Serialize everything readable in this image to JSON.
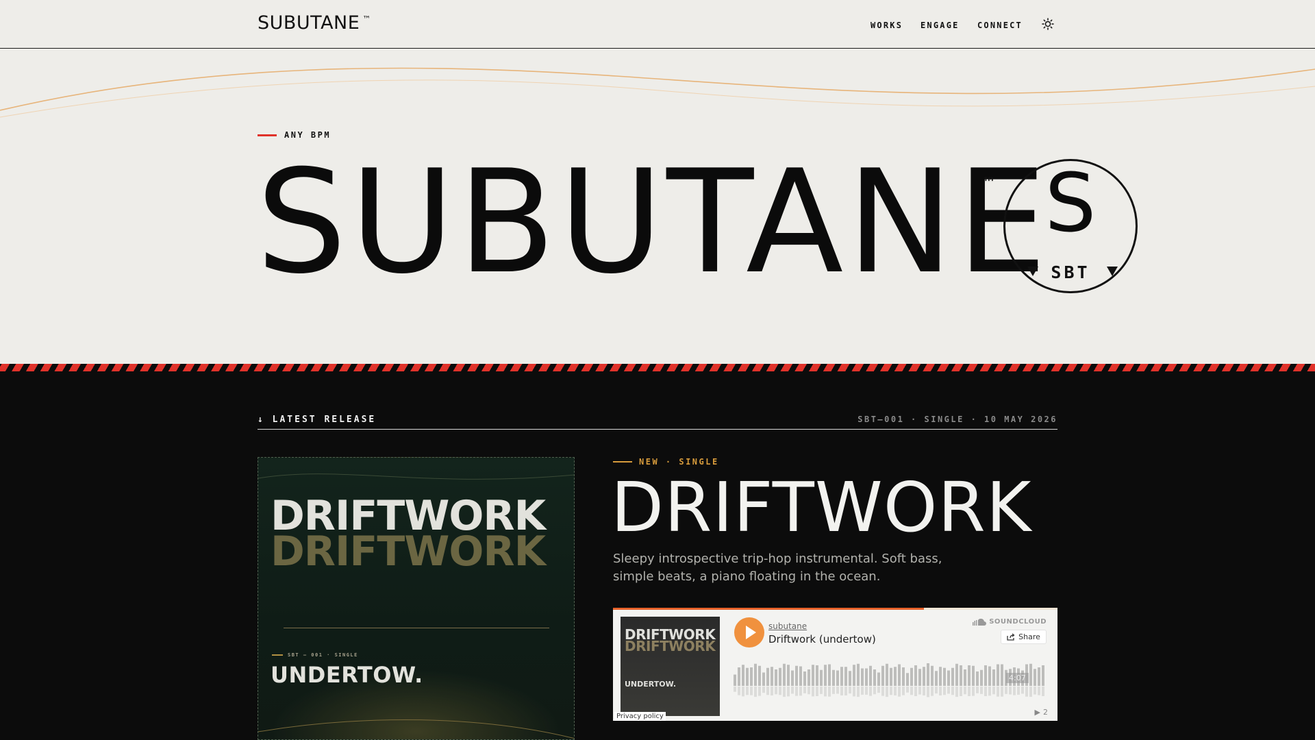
{
  "header": {
    "brand": "SUBUTANE",
    "brand_tm": "™",
    "nav": [
      "WORKS",
      "ENGAGE",
      "CONNECT"
    ],
    "theme_icon": "sun-icon"
  },
  "hero": {
    "kicker": "ANY BPM",
    "title": "SUBUTANE",
    "tm": "™",
    "seal_letter": "S",
    "seal_text": "SBT"
  },
  "release": {
    "section_label": "↓ LATEST RELEASE",
    "section_meta": "SBT—001 · SINGLE · 10 MAY 2026",
    "cover": {
      "title": "DRIFTWORK",
      "meta": "SBT — 001 · SINGLE",
      "subtitle": "UNDERTOW."
    },
    "tag": "NEW · SINGLE",
    "title": "DRIFTWORK",
    "description": "Sleepy introspective trip-hop instrumental. Soft bass, simple beats, a piano floating in the ocean."
  },
  "player": {
    "art_title": "DRIFTWORK",
    "art_subtitle": "UNDERTOW.",
    "privacy": "Privacy policy",
    "user": "subutane",
    "track": "Driftwork (undertow)",
    "brand": "SOUNDCLOUD",
    "share": "Share",
    "duration": "4:07",
    "plays": "2",
    "progress": 0.7,
    "accent": "#e8632b",
    "play_color": "#f0913e"
  },
  "colors": {
    "hazard_red": "#e0322a",
    "release_accent": "#d89c3c",
    "page_light": "#eeede9",
    "page_dark": "#0c0c0c"
  }
}
